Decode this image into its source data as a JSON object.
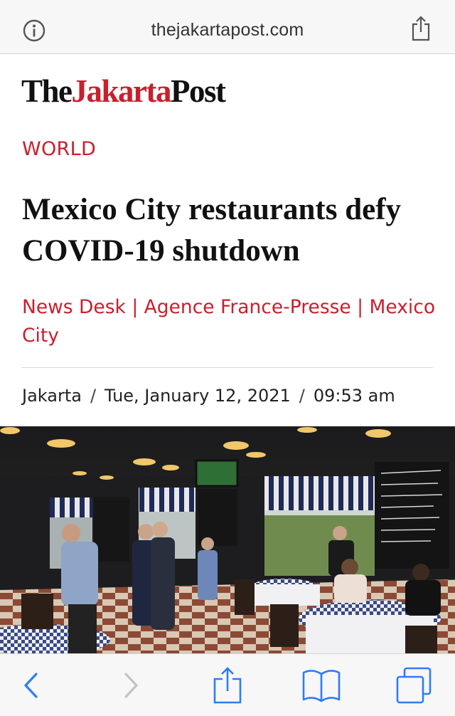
{
  "browser": {
    "url": "thejakartapost.com",
    "icons": [
      "info-icon",
      "share-icon"
    ]
  },
  "logo": {
    "part1": "The",
    "part2": "Jakarta",
    "part3": "Post"
  },
  "article": {
    "section": "WORLD",
    "headline": "Mexico City restaurants defy COVID-19 shutdown",
    "byline": "News Desk | Agence France-Presse | Mexico City",
    "location": "Jakarta",
    "date": "Tue, January 12, 2021",
    "time": "09:53 am",
    "separator": "/"
  },
  "colors": {
    "brand_red": "#c8202d",
    "ios_blue": "#2f7cf6",
    "toolbar_bg": "#f7f7f7"
  },
  "toolbar": {
    "icons": [
      "back-icon",
      "forward-icon",
      "share-icon",
      "bookmarks-icon",
      "tabs-icon"
    ]
  }
}
